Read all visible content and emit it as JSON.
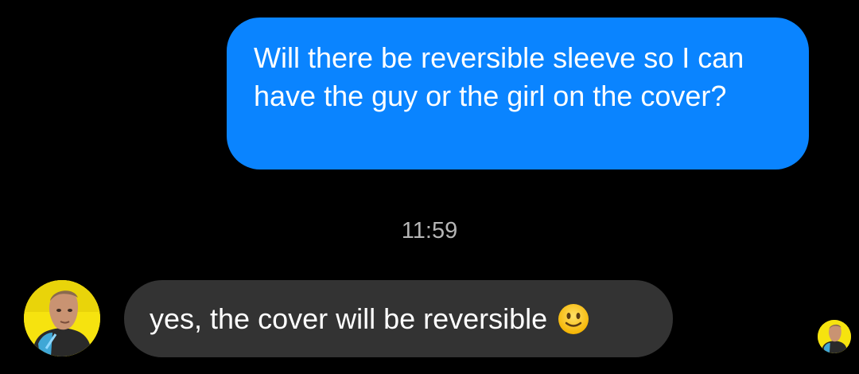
{
  "messages": {
    "outgoing": {
      "text": "Will there be reversible sleeve so I can have the guy or the girl on the cover?"
    },
    "timestamp": "11:59",
    "incoming": {
      "text": "yes, the cover will be reversible",
      "emoji_icon": "slightly-smiling-face-icon"
    }
  },
  "colors": {
    "outgoing_bubble": "#0a84ff",
    "incoming_bubble": "#333333",
    "background": "#000000",
    "avatar_ring": "#f6e30f"
  }
}
